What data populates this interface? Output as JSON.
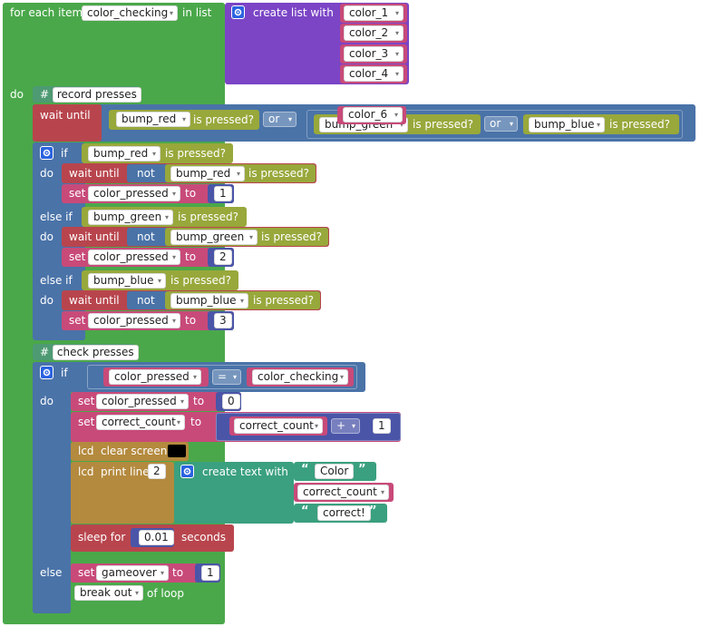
{
  "colors": {
    "loop": "#4aa84a",
    "list": "#7b45c6",
    "item": "#c84a79",
    "logic": "#4a73a8",
    "sensor": "#98a83b",
    "math": "#4a55a8",
    "text": "#3aa07f",
    "lcd": "#b48a3e",
    "wait": "#b8454d",
    "comment": "#4e9a73"
  },
  "foreach": {
    "label": "for each item",
    "var": "color_checking",
    "in_list": "in list",
    "create_list": "create list with",
    "items": [
      "color_1",
      "color_2",
      "color_3",
      "color_4",
      "color_6"
    ],
    "do": "do"
  },
  "record": {
    "comment": "record presses",
    "wait_until": "wait until",
    "is_pressed": "is pressed?",
    "or": "or",
    "bump_red": "bump_red",
    "bump_green": "bump_green",
    "bump_blue": "bump_blue"
  },
  "ifblock": {
    "if": "if",
    "do": "do",
    "else_if": "else if",
    "not": "not",
    "set": "set",
    "to": "to",
    "var": "color_pressed",
    "values": [
      "1",
      "2",
      "3"
    ]
  },
  "check": {
    "comment": "check presses",
    "if": "if",
    "do": "do",
    "else": "else",
    "eq": "=",
    "color_pressed": "color_pressed",
    "color_checking": "color_checking",
    "set": "set",
    "to": "to",
    "zero": "0",
    "correct_count": "correct_count",
    "plus": "+",
    "one": "1",
    "lcd": "lcd",
    "clear_screen": "clear screen",
    "print_line": "print line",
    "line_no": "2",
    "create_text": "create text with",
    "text_color": "Color",
    "text_correct": "correct!",
    "sleep_for": "sleep for",
    "sleep_val": "0.01",
    "seconds": "seconds",
    "gameover": "gameover",
    "gameover_val": "1",
    "break_out": "break out",
    "of_loop": "of loop"
  }
}
